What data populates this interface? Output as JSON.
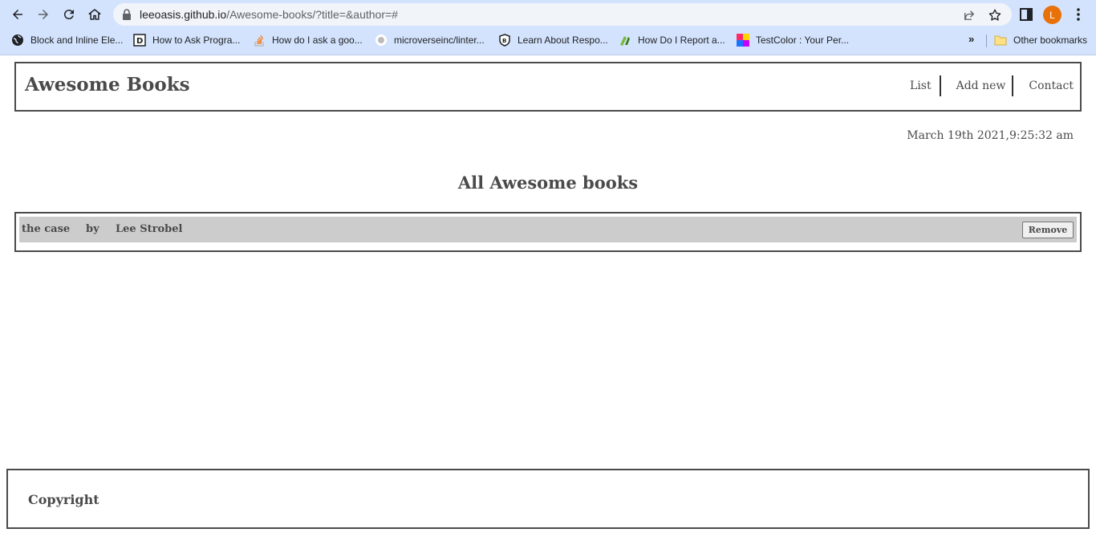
{
  "browser": {
    "url_host": "leeoasis.github.io",
    "url_path": "/Awesome-books/?title=&author=#",
    "avatar_initial": "L",
    "bookmarks": [
      {
        "label": "Block and Inline Ele...",
        "icon": "globe-icon"
      },
      {
        "label": "How to Ask Progra...",
        "icon": "dev-icon"
      },
      {
        "label": "How do I ask a goo...",
        "icon": "stackoverflow-icon"
      },
      {
        "label": "microverseinc/linter...",
        "icon": "github-icon"
      },
      {
        "label": "Learn About Respo...",
        "icon": "shield-icon"
      },
      {
        "label": "How Do I Report a...",
        "icon": "leaf-icon"
      },
      {
        "label": "TestColor : Your Per...",
        "icon": "color-grid-icon"
      }
    ],
    "more_bookmarks": "»",
    "other_bookmarks": "Other bookmarks",
    "accent": "#d3e3fd"
  },
  "site": {
    "logo": "Awesome Books",
    "nav": {
      "list": "List",
      "add_new": "Add new",
      "contact": "Contact"
    },
    "datetime": "March 19th 2021,9:25:32 am",
    "section_title": "All Awesome books",
    "books": [
      {
        "title": "the case",
        "by": "by",
        "author": "Lee Strobel",
        "remove_label": "Remove"
      }
    ],
    "footer": "Copyright"
  }
}
